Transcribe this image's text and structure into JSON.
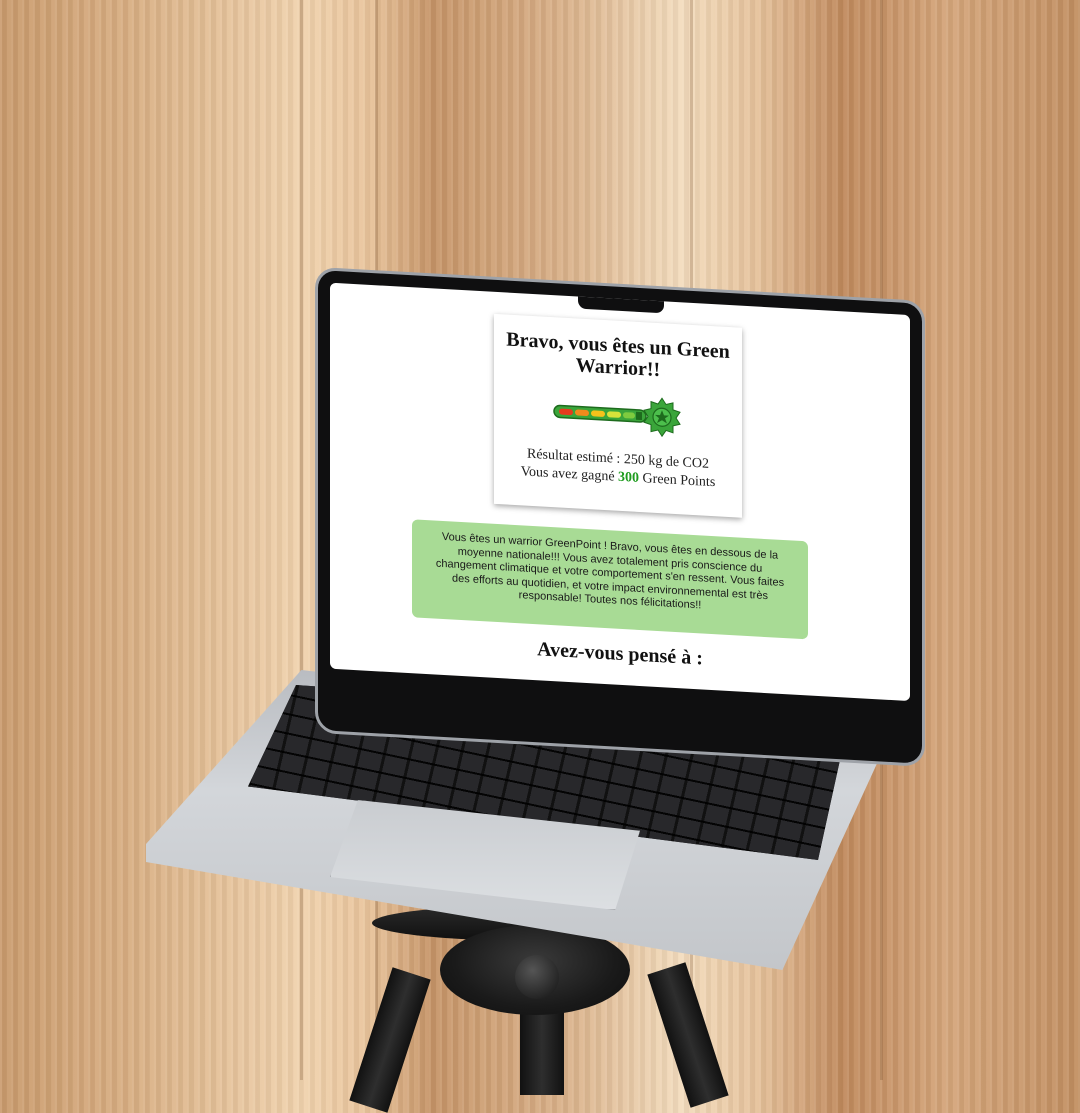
{
  "colors": {
    "card_background": "#ffffff",
    "message_background": "#a8db95",
    "points_color": "#1f9c1f",
    "gauge_green": "#3aa53a"
  },
  "result_card": {
    "title": "Bravo, vous êtes un Green Warrior!!",
    "gauge_icon": "star-badge-icon",
    "result_text": "Résultat estimé : 250 kg de CO2",
    "points_prefix": "Vous avez gagné ",
    "points_value": "300",
    "points_suffix": " Green Points"
  },
  "message": {
    "text": "Vous êtes un warrior GreenPoint ! Bravo, vous êtes en dessous de la moyenne nationale!!! Vous avez totalement pris conscience du changement climatique et votre comportement s'en ressent. Vous faites des efforts au quotidien, et votre impact environnemental est très responsable! Toutes nos félicitations!!"
  },
  "section": {
    "title": "Avez-vous pensé à :"
  }
}
